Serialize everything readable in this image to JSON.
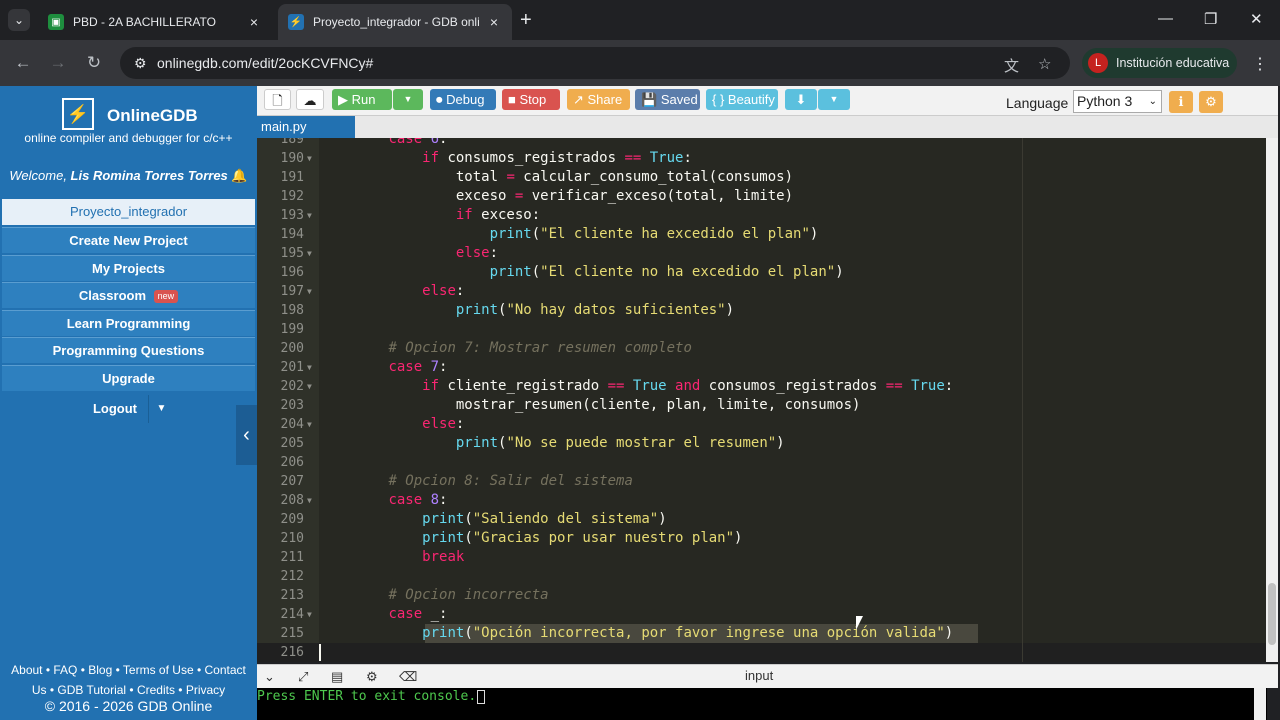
{
  "browser": {
    "tabs": [
      {
        "title": "PBD - 2A BACHILLERATO",
        "close": "×"
      },
      {
        "title": "Proyecto_integrador - GDB onli",
        "close": "×"
      }
    ],
    "new_tab": "+",
    "url": "onlinegdb.com/edit/2ocKCVFNCy#",
    "profile": {
      "initial": "L",
      "name": "Institución educativa"
    }
  },
  "sidebar": {
    "brand": "OnlineGDB",
    "tagline": "online compiler and debugger for c/c++",
    "welcome_prefix": "Welcome, ",
    "user": "Lis Romina Torres Torres",
    "items": [
      "Proyecto_integrador",
      "Create New Project",
      "My Projects",
      "Classroom",
      "Learn Programming",
      "Programming Questions",
      "Upgrade"
    ],
    "new_badge": "new",
    "logout": "Logout",
    "footer_line1": "About • FAQ • Blog • Terms of Use • Contact",
    "footer_line2": "Us • GDB Tutorial • Credits • Privacy",
    "copyright": "© 2016 - 2026 GDB Online"
  },
  "toolbar": {
    "run": "Run",
    "debug": "Debug",
    "stop": "Stop",
    "share": "Share",
    "saved": "Saved",
    "beautify": "{ } Beautify",
    "language_label": "Language",
    "language": "Python 3"
  },
  "file_tab": "main.py",
  "colors": {
    "sidebar": "#2271b1",
    "run": "#5cb85c",
    "stop": "#d9534f",
    "share": "#f0ad4e",
    "debug": "#337ab7",
    "editor_bg": "#272822"
  },
  "console": {
    "label": "input",
    "text": "Press ENTER to exit console."
  }
}
